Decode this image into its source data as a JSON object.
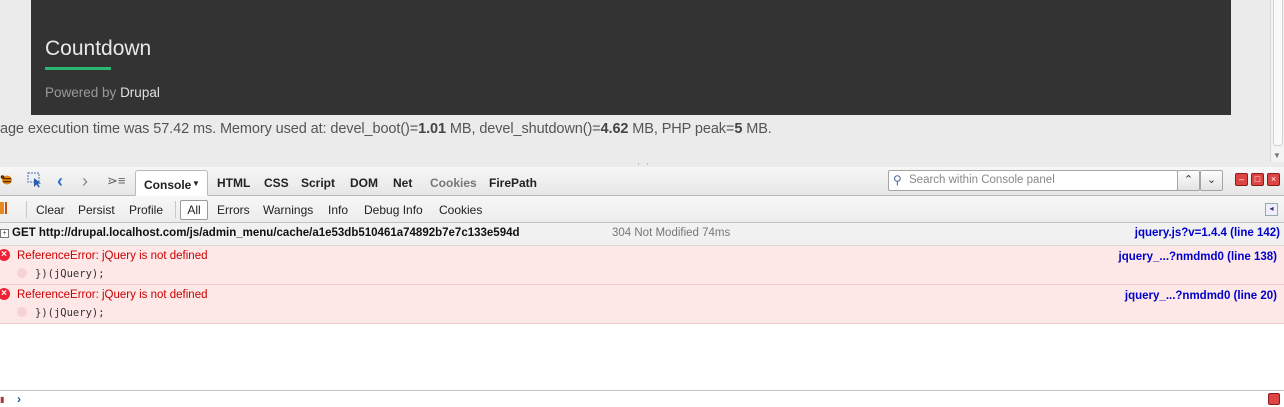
{
  "page": {
    "footer_title": "Countdown",
    "powered_prefix": "Powered by",
    "powered_link": "Drupal",
    "devel": {
      "prefix": "age execution time was 57.42 ms. Memory used at: devel_boot()=",
      "boot": "1.01",
      "mid": " MB, devel_shutdown()=",
      "shutdown": "4.62",
      "mid2": " MB, PHP peak=",
      "peak": "5",
      "suffix": " MB."
    }
  },
  "firebug": {
    "tabs": {
      "console": "Console",
      "html": "HTML",
      "css": "CSS",
      "script": "Script",
      "dom": "DOM",
      "net": "Net",
      "cookies": "Cookies",
      "firepath": "FirePath"
    },
    "search_placeholder": "Search within Console panel",
    "toolbar2": {
      "clear": "Clear",
      "persist": "Persist",
      "profile": "Profile",
      "all": "All",
      "errors": "Errors",
      "warnings": "Warnings",
      "info": "Info",
      "debug_info": "Debug Info",
      "cookies": "Cookies"
    },
    "entries": {
      "get": {
        "text": "GET http://drupal.localhost.com/js/admin_menu/cache/a1e53db510461a74892b7e7c133e594d",
        "status": "304 Not Modified 74ms",
        "source": "jquery.js?v=1.4.4 (line 142)"
      },
      "error1": {
        "message": "ReferenceError: jQuery is not defined",
        "code": "})(jQuery);",
        "source": "jquery_...?nmdmd0 (line 138)"
      },
      "error2": {
        "message": "ReferenceError: jQuery is not defined",
        "code": "})(jQuery);",
        "source": "jquery_...?nmdmd0 (line 20)"
      }
    },
    "command_prompt": "›"
  },
  "colors": {
    "accent": "#2bb673",
    "error_bg": "#fde7e7",
    "error_text": "#cc0000",
    "link": "#0000cc"
  },
  "icons": [
    "firebug-icon",
    "inspect-icon",
    "back-arrow-icon",
    "forward-arrow-icon",
    "command-editor-icon",
    "search-icon",
    "chevron-up-icon",
    "chevron-down-icon",
    "minimize-icon",
    "detach-icon",
    "close-icon",
    "error-icon",
    "expand-icon",
    "side-panel-icon"
  ]
}
